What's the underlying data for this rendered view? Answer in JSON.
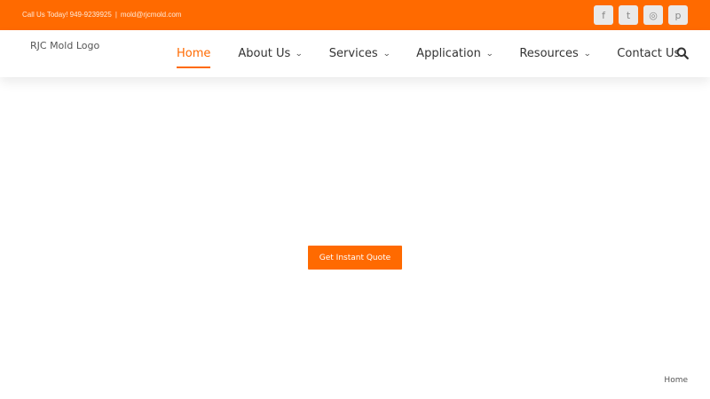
{
  "topbar": {
    "phone": "Call Us Today! 949-9239925",
    "separator": "|",
    "email": "mold@rjcmold.com",
    "socials": [
      {
        "name": "facebook-icon",
        "glyph": "f"
      },
      {
        "name": "twitter-icon",
        "glyph": "t"
      },
      {
        "name": "instagram-icon",
        "glyph": "◎"
      },
      {
        "name": "pinterest-icon",
        "glyph": "p"
      }
    ]
  },
  "header": {
    "logo_alt": "RJC Mold Logo",
    "nav": [
      {
        "label": "Home",
        "active": true,
        "dropdown": false
      },
      {
        "label": "About Us",
        "active": false,
        "dropdown": true
      },
      {
        "label": "Services",
        "active": false,
        "dropdown": true
      },
      {
        "label": "Application",
        "active": false,
        "dropdown": true
      },
      {
        "label": "Resources",
        "active": false,
        "dropdown": true
      },
      {
        "label": "Contact Us",
        "active": false,
        "dropdown": false
      }
    ],
    "search_icon": "search-icon"
  },
  "hero": {
    "cta_label": "Get Instant Quote"
  },
  "breadcrumb": {
    "home_label": "Home"
  },
  "colors": {
    "accent": "#ff6a00",
    "social_bg": "#e9e9e9",
    "text": "#333333"
  }
}
